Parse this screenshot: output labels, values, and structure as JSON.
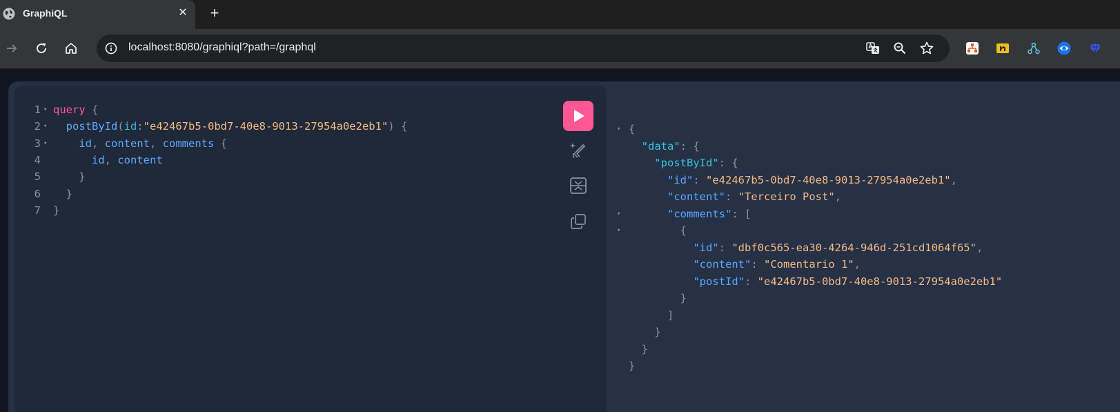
{
  "browser": {
    "tab_title": "GraphiQL",
    "tab_close": "✕",
    "new_tab": "+",
    "url": "localhost:8080/graphiql?path=/graphql"
  },
  "colors": {
    "accent": "#ff5794",
    "keyword": "#ff5794",
    "field": "#5ea8ff",
    "string": "#f4b982"
  },
  "editor": {
    "lines": [
      {
        "n": "1",
        "fold": true,
        "parts": [
          [
            "kw",
            "query"
          ],
          [
            "pun",
            " {"
          ]
        ]
      },
      {
        "n": "2",
        "fold": true,
        "parts": [
          [
            "pun",
            "  "
          ],
          [
            "fld",
            "postById"
          ],
          [
            "pun",
            "("
          ],
          [
            "arg",
            "id"
          ],
          [
            "pun",
            ":"
          ],
          [
            "str",
            "\"e42467b5-0bd7-40e8-9013-27954a0e2eb1\""
          ],
          [
            "pun",
            ") {"
          ]
        ]
      },
      {
        "n": "3",
        "fold": true,
        "parts": [
          [
            "pun",
            "    "
          ],
          [
            "fld",
            "id"
          ],
          [
            "pun",
            ", "
          ],
          [
            "fld",
            "content"
          ],
          [
            "pun",
            ", "
          ],
          [
            "fld",
            "comments"
          ],
          [
            "pun",
            " {"
          ]
        ]
      },
      {
        "n": "4",
        "fold": false,
        "parts": [
          [
            "pun",
            "      "
          ],
          [
            "fld",
            "id"
          ],
          [
            "pun",
            ", "
          ],
          [
            "fld",
            "content"
          ]
        ]
      },
      {
        "n": "5",
        "fold": false,
        "parts": [
          [
            "pun",
            "    }"
          ]
        ]
      },
      {
        "n": "6",
        "fold": false,
        "parts": [
          [
            "pun",
            "  }"
          ]
        ]
      },
      {
        "n": "7",
        "fold": false,
        "parts": [
          [
            "pun",
            "}"
          ]
        ]
      }
    ]
  },
  "toolbar_icons": [
    "execute-icon",
    "prettify-icon",
    "merge-icon",
    "copy-icon"
  ],
  "result": {
    "lines": [
      {
        "fold": true,
        "parts": [
          [
            "pun",
            "{"
          ]
        ]
      },
      {
        "fold": false,
        "parts": [
          [
            "pun",
            "  "
          ],
          [
            "key2",
            "\"data\""
          ],
          [
            "pun",
            ": {"
          ]
        ]
      },
      {
        "fold": false,
        "parts": [
          [
            "pun",
            "    "
          ],
          [
            "key2",
            "\"postById\""
          ],
          [
            "pun",
            ": {"
          ]
        ]
      },
      {
        "fold": false,
        "parts": [
          [
            "pun",
            "      "
          ],
          [
            "key",
            "\"id\""
          ],
          [
            "pun",
            ": "
          ],
          [
            "str",
            "\"e42467b5-0bd7-40e8-9013-27954a0e2eb1\""
          ],
          [
            "pun",
            ","
          ]
        ]
      },
      {
        "fold": false,
        "parts": [
          [
            "pun",
            "      "
          ],
          [
            "key",
            "\"content\""
          ],
          [
            "pun",
            ": "
          ],
          [
            "str",
            "\"Terceiro Post\""
          ],
          [
            "pun",
            ","
          ]
        ]
      },
      {
        "fold": true,
        "parts": [
          [
            "pun",
            "      "
          ],
          [
            "key",
            "\"comments\""
          ],
          [
            "pun",
            ": ["
          ]
        ]
      },
      {
        "fold": true,
        "parts": [
          [
            "pun",
            "        {"
          ]
        ]
      },
      {
        "fold": false,
        "parts": [
          [
            "pun",
            "          "
          ],
          [
            "key",
            "\"id\""
          ],
          [
            "pun",
            ": "
          ],
          [
            "str",
            "\"dbf0c565-ea30-4264-946d-251cd1064f65\""
          ],
          [
            "pun",
            ","
          ]
        ]
      },
      {
        "fold": false,
        "parts": [
          [
            "pun",
            "          "
          ],
          [
            "key",
            "\"content\""
          ],
          [
            "pun",
            ": "
          ],
          [
            "str",
            "\"Comentario 1\""
          ],
          [
            "pun",
            ","
          ]
        ]
      },
      {
        "fold": false,
        "parts": [
          [
            "pun",
            "          "
          ],
          [
            "key",
            "\"postId\""
          ],
          [
            "pun",
            ": "
          ],
          [
            "str",
            "\"e42467b5-0bd7-40e8-9013-27954a0e2eb1\""
          ]
        ]
      },
      {
        "fold": false,
        "parts": [
          [
            "pun",
            "        }"
          ]
        ]
      },
      {
        "fold": false,
        "parts": [
          [
            "pun",
            "      ]"
          ]
        ]
      },
      {
        "fold": false,
        "parts": [
          [
            "pun",
            "    }"
          ]
        ]
      },
      {
        "fold": false,
        "parts": [
          [
            "pun",
            "  }"
          ]
        ]
      },
      {
        "fold": false,
        "parts": [
          [
            "pun",
            "}"
          ]
        ]
      }
    ]
  }
}
